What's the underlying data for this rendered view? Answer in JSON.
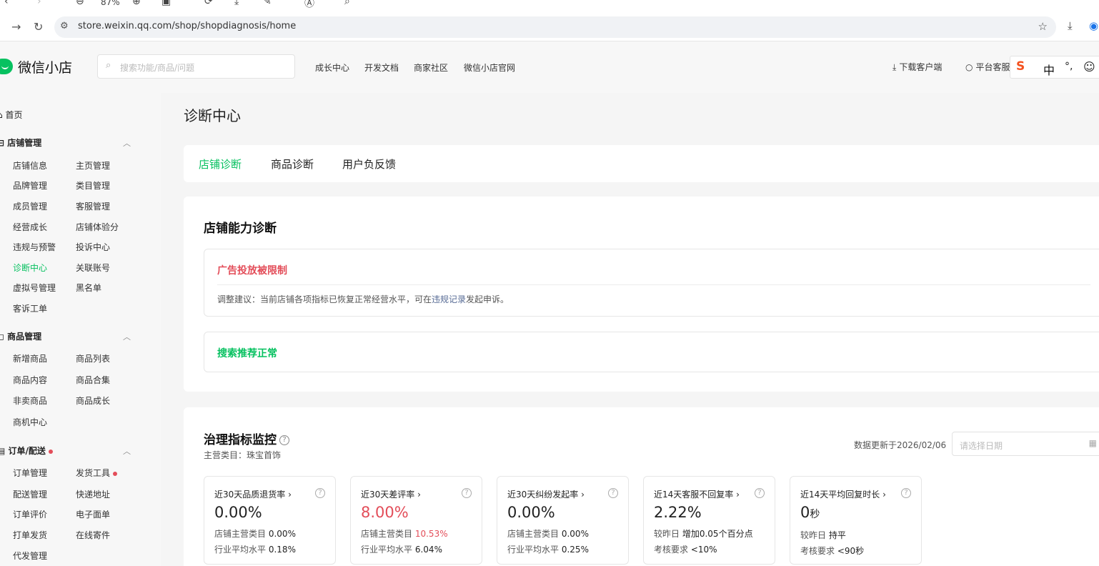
{
  "browser": {
    "zoom": "87%",
    "url": "store.weixin.qq.com/shop/shopdiagnosis/home"
  },
  "header": {
    "logo_text": "微信小店",
    "search_placeholder": "搜索功能/商品/问题",
    "nav": [
      "成长中心",
      "开发文档",
      "商家社区",
      "微信小店官网"
    ],
    "download_client": "下载客户端",
    "platform_service": "平台客服",
    "ime_lang": "中"
  },
  "sidebar": {
    "home": "首页",
    "sections": [
      {
        "title": "店铺管理",
        "items": [
          "店铺信息",
          "主页管理",
          "品牌管理",
          "类目管理",
          "成员管理",
          "客服管理",
          "经营成长",
          "店铺体验分",
          "违规与预警",
          "投诉中心",
          "诊断中心",
          "关联账号",
          "虚拟号管理",
          "黑名单",
          "客诉工单"
        ]
      },
      {
        "title": "商品管理",
        "items": [
          "新增商品",
          "商品列表",
          "商品内容",
          "商品合集",
          "非卖商品",
          "商品成长",
          "商机中心"
        ]
      },
      {
        "title": "订单/配送",
        "items": [
          "订单管理",
          "发货工具",
          "配送管理",
          "快递地址",
          "订单评价",
          "电子面单",
          "打单发货",
          "在线寄件",
          "代发管理"
        ]
      }
    ]
  },
  "main": {
    "page_title": "诊断中心",
    "tabs": [
      "店铺诊断",
      "商品诊断",
      "用户负反馈"
    ],
    "capability": {
      "title": "店铺能力诊断",
      "warning_title": "广告投放被限制",
      "advice_prefix": "调整建议：当前店铺各项指标已恢复正常经营水平，可在",
      "advice_link": "违规记录",
      "advice_suffix": "发起申诉。",
      "ok_title": "搜索推荐正常"
    },
    "governance": {
      "title": "治理指标监控",
      "main_category": "主营类目：珠宝首饰",
      "updated": "数据更新于2026/02/06",
      "date_placeholder": "请选择日期",
      "metrics": [
        {
          "title": "近30天品质退货率",
          "value": "0.00%",
          "row1_label": "店铺主营类目",
          "row1_value": "0.00%",
          "row2_label": "行业平均水平",
          "row2_value": "0.18%"
        },
        {
          "title": "近30天差评率",
          "value": "8.00%",
          "row1_label": "店铺主营类目",
          "row1_value": "10.53%",
          "row2_label": "行业平均水平",
          "row2_value": "6.04%"
        },
        {
          "title": "近30天纠纷发起率",
          "value": "0.00%",
          "row1_label": "店铺主营类目",
          "row1_value": "0.00%",
          "row2_label": "行业平均水平",
          "row2_value": "0.25%"
        },
        {
          "title": "近14天客服不回复率",
          "value": "2.22%",
          "row1_label": "较昨日",
          "row1_value": "增加0.05个百分点",
          "row2_label": "考核要求",
          "row2_value": "<10%"
        },
        {
          "title": "近14天平均回复时长",
          "value": "0",
          "value_unit": "秒",
          "row1_label": "较昨日",
          "row1_value": "持平",
          "row2_label": "考核要求",
          "row2_value": "<90秒"
        }
      ]
    }
  },
  "colors": {
    "brand_green": "#07c160",
    "alert_red": "#e34d59",
    "link_blue": "#576b95"
  }
}
